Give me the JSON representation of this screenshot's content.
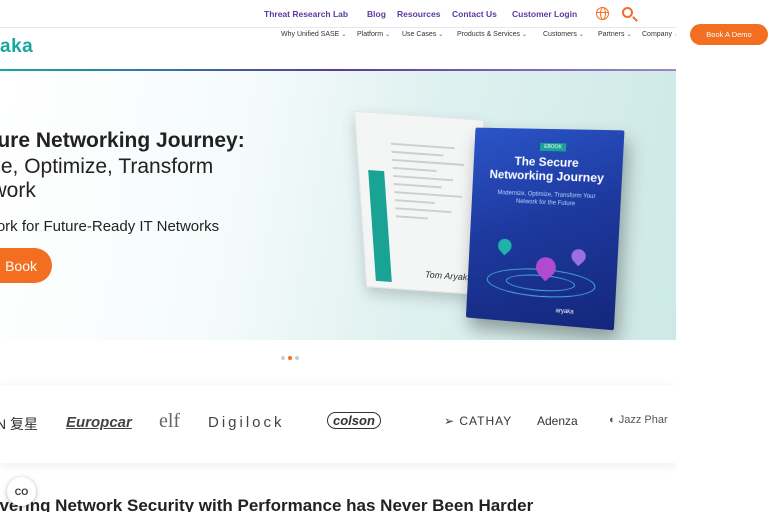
{
  "utility_nav": [
    "Threat Research Lab",
    "Blog",
    "Resources",
    "Contact Us",
    "Customer Login"
  ],
  "logo_text": "aka",
  "main_nav": [
    "Why Unified SASE",
    "Platform",
    "Use Cases",
    "Products & Services",
    "Customers",
    "Partners",
    "Company"
  ],
  "demo_button": "Book A Demo",
  "hero": {
    "title_line1": "ecure Networking Journey:",
    "title_line2": "nize, Optimize, Transform",
    "title_line3": "etwork",
    "subtitle": "work for Future-Ready IT Networks",
    "cta": "Book"
  },
  "book": {
    "tag": "EBOOK",
    "title": "The Secure Networking Journey",
    "subtitle": "Modernize, Optimize, Transform Your Network for the Future",
    "logo": "aryaka",
    "signature": "Tom Aryaka"
  },
  "carousel": {
    "slides": 3,
    "active": 2
  },
  "customer_logos": [
    "N 复星",
    "Europcar",
    "elf",
    "Digilock",
    "colson",
    "CATHAY",
    "Adenza",
    "Jazz Phar"
  ],
  "section_title": "livering Network Security with Performance has Never Been Harder",
  "cookie_button": "CO",
  "colors": {
    "accent": "#f36e21",
    "brand_teal": "#16a7a0",
    "nav_purple": "#5a3aa0"
  }
}
